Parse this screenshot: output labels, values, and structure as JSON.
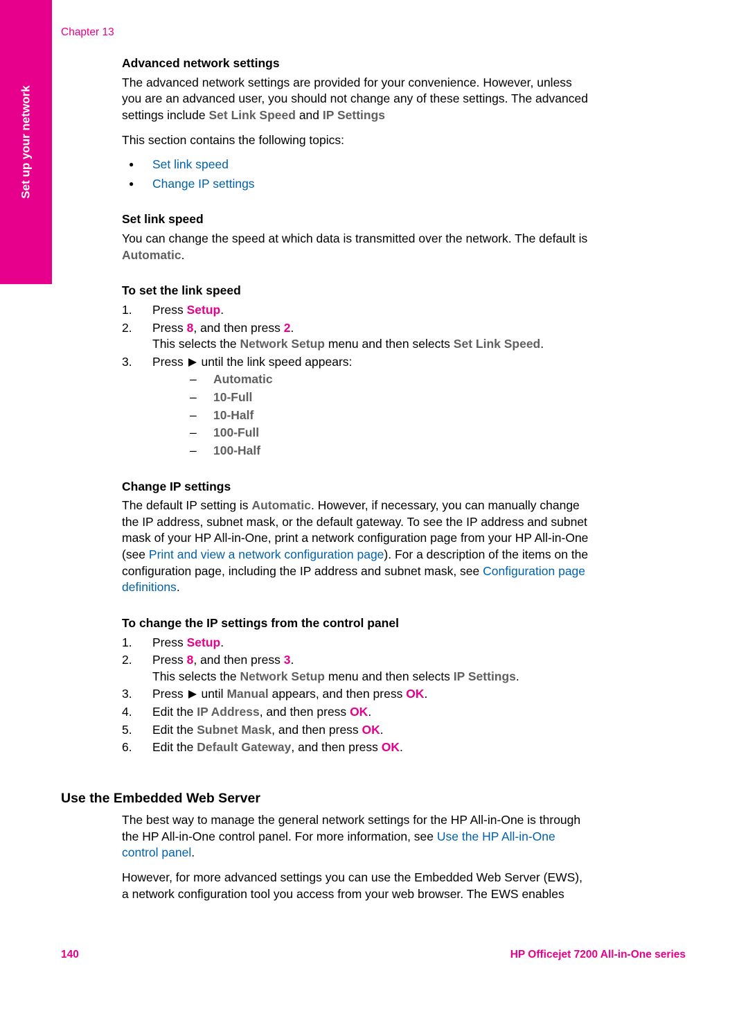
{
  "sideTab": "Set up your network",
  "chapterLabel": "Chapter 13",
  "advNet": {
    "heading": "Advanced network settings",
    "para1_a": "The advanced network settings are provided for your convenience. However, unless you are an advanced user, you should not change any of these settings. The advanced settings include ",
    "setLinkSpeed": "Set Link Speed",
    "and": " and ",
    "ipSettings": "IP Settings",
    "topicsIntro": "This section contains the following topics:",
    "bullets": {
      "b1": "Set link speed",
      "b2": "Change IP settings"
    }
  },
  "setLink": {
    "heading": "Set link speed",
    "para_a": "You can change the speed at which data is transmitted over the network. The default is ",
    "automatic": "Automatic",
    "period": "."
  },
  "toSetLink": {
    "heading": "To set the link speed",
    "step1_a": "Press ",
    "step1_setup": "Setup",
    "step1_end": ".",
    "step2_a": "Press ",
    "eight": "8",
    "step2_b": ", and then press ",
    "two": "2",
    "step2_end": ".",
    "step2_sub_a": "This selects the ",
    "networkSetup": "Network Setup",
    "step2_sub_b": " menu and then selects ",
    "setLinkSpeed": "Set Link Speed",
    "step2_sub_end": ".",
    "step3_a": "Press ",
    "step3_b": " until the link speed appears:",
    "opts": {
      "o1": "Automatic",
      "o2": "10-Full",
      "o3": "10-Half",
      "o4": "100-Full",
      "o5": "100-Half"
    }
  },
  "changeIP": {
    "heading": "Change IP settings",
    "para_a": "The default IP setting is ",
    "automatic": "Automatic",
    "para_b": ". However, if necessary, you can manually change the IP address, subnet mask, or the default gateway. To see the IP address and subnet mask of your HP All-in-One, print a network configuration page from your HP All-in-One (see ",
    "link1": "Print and view a network configuration page",
    "para_c": "). For a description of the items on the configuration page, including the IP address and subnet mask, see ",
    "link2": "Configuration page definitions",
    "para_end": "."
  },
  "toChangeIP": {
    "heading": "To change the IP settings from the control panel",
    "step1_a": "Press ",
    "setup": "Setup",
    "step1_end": ".",
    "step2_a": "Press ",
    "eight": "8",
    "step2_b": ", and then press ",
    "three": "3",
    "step2_end": ".",
    "step2_sub_a": "This selects the ",
    "networkSetup": "Network Setup",
    "step2_sub_b": " menu and then selects ",
    "ipSettings": "IP Settings",
    "step2_sub_end": ".",
    "step3_a": "Press ",
    "step3_b": " until ",
    "manual": "Manual",
    "step3_c": " appears, and then press ",
    "ok": "OK",
    "step3_end": ".",
    "step4_a": "Edit the ",
    "ipAddress": "IP Address",
    "step4_b": ", and then press ",
    "step4_end": ".",
    "step5_a": "Edit the ",
    "subnetMask": "Subnet Mask",
    "step5_b": ", and then press ",
    "step5_end": ".",
    "step6_a": "Edit the ",
    "defaultGateway": "Default Gateway",
    "step6_b": ", and then press ",
    "step6_end": "."
  },
  "ews": {
    "heading": "Use the Embedded Web Server",
    "para1_a": "The best way to manage the general network settings for the HP All-in-One is through the HP All-in-One control panel. For more information, see ",
    "link": "Use the HP All-in-One control panel",
    "para1_end": ".",
    "para2": "However, for more advanced settings you can use the Embedded Web Server (EWS), a network configuration tool you access from your web browser. The EWS enables"
  },
  "footer": {
    "page": "140",
    "product": "HP Officejet 7200 All-in-One series"
  }
}
